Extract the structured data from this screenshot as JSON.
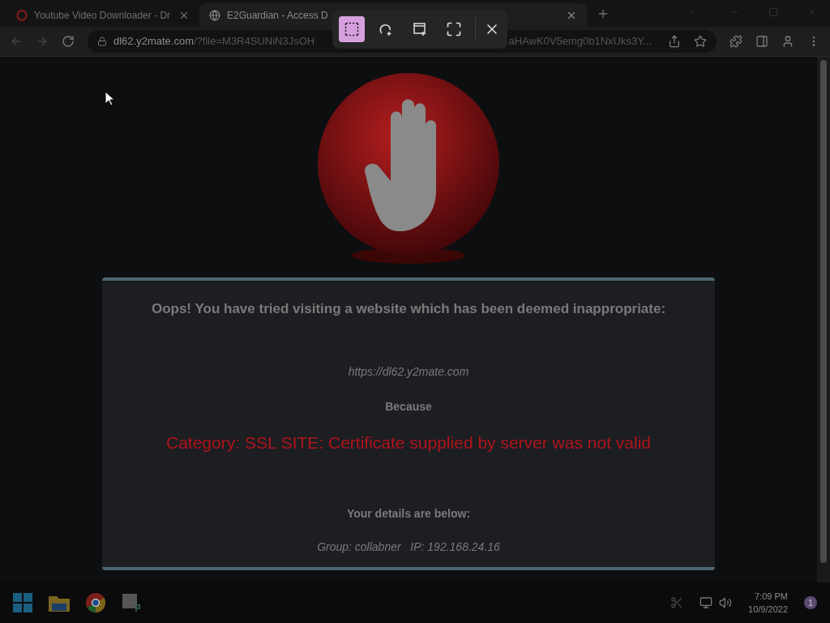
{
  "browser": {
    "tabs": [
      {
        "title": "Youtube Video Downloader - Dr",
        "selected": false
      },
      {
        "title": "E2Guardian - Access D",
        "selected": true
      }
    ],
    "address": {
      "host": "dl62.y2mate.com",
      "path_start": "/?file=M3R4SUNiN3JsOH",
      "path_end": "aHAwK0V5emg0b1NxUks3Y..."
    }
  },
  "snip_toolbar": {
    "modes": [
      {
        "kind": "rectangle",
        "selected": true
      },
      {
        "kind": "freeform",
        "selected": false
      },
      {
        "kind": "window",
        "selected": false
      },
      {
        "kind": "fullscreen",
        "selected": false
      }
    ]
  },
  "page": {
    "message": "Oops! You have tried visiting a website which has been deemed inappropriate:",
    "url": "https://dl62.y2mate.com",
    "because": "Because",
    "reason": "Category: SSL SITE: Certificate supplied by server was not valid",
    "details_heading": "Your details are below:",
    "details": "Group: collabner   IP: 192.168.24.16"
  },
  "taskbar": {
    "time": "7:09 PM",
    "date": "10/9/2022",
    "notifications": "1"
  }
}
